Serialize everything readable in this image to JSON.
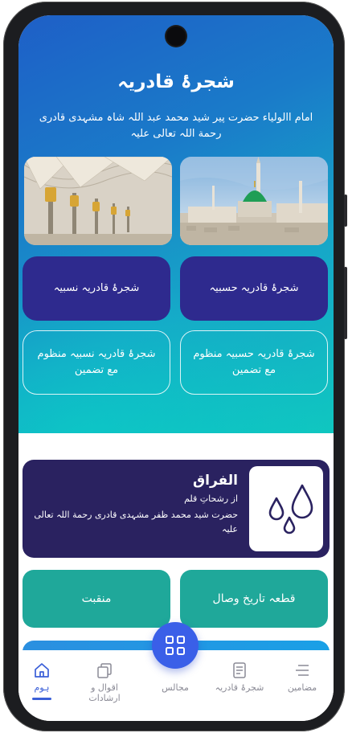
{
  "header": {
    "title": "شجرۂ قادریہ",
    "subtitle": "امام االولیاء حضرت پیر شید محمد عبد اللہ شاہ مشہدی قادری رحمة اللہ تعالی علیہ"
  },
  "tiles": {
    "hasbiya": "شجرۂ قادریہ حسبیہ",
    "nasbiya": "شجرۂ قادریہ نسبیہ",
    "hasbiya_manzoom": "شجرۂ قادریہ حسبیہ منظوم مع تضمین",
    "nasbiya_manzoom": "شجرۂ قادریہ نسبیہ منظوم مع تضمین"
  },
  "feature": {
    "title": "الفراق",
    "source": "از رشحاتِ قلم",
    "author": "حضرت شید محمد ظفر مشہدی قادری رحمة اللہ تعالی علیہ",
    "icon": "water-drops-icon"
  },
  "buttons": {
    "qatai": "قطعہ تاریخ وصال",
    "manqabat": "منقبت"
  },
  "nav": {
    "items": [
      {
        "label": "مضامین",
        "icon": "menu-lines-icon"
      },
      {
        "label": "شجرۂ قادریہ",
        "icon": "document-icon"
      },
      {
        "label": "مجالس",
        "icon": "grid-icon"
      },
      {
        "label": "اقوال و ارشادات",
        "icon": "copy-icon"
      },
      {
        "label": "ہوم",
        "icon": "home-icon"
      }
    ],
    "active": "ہوم"
  },
  "colors": {
    "accent": "#3a5fd8",
    "tile_dark": "#2e2a8e",
    "teal": "#1fa89a",
    "feature_bg": "#2a2260"
  }
}
